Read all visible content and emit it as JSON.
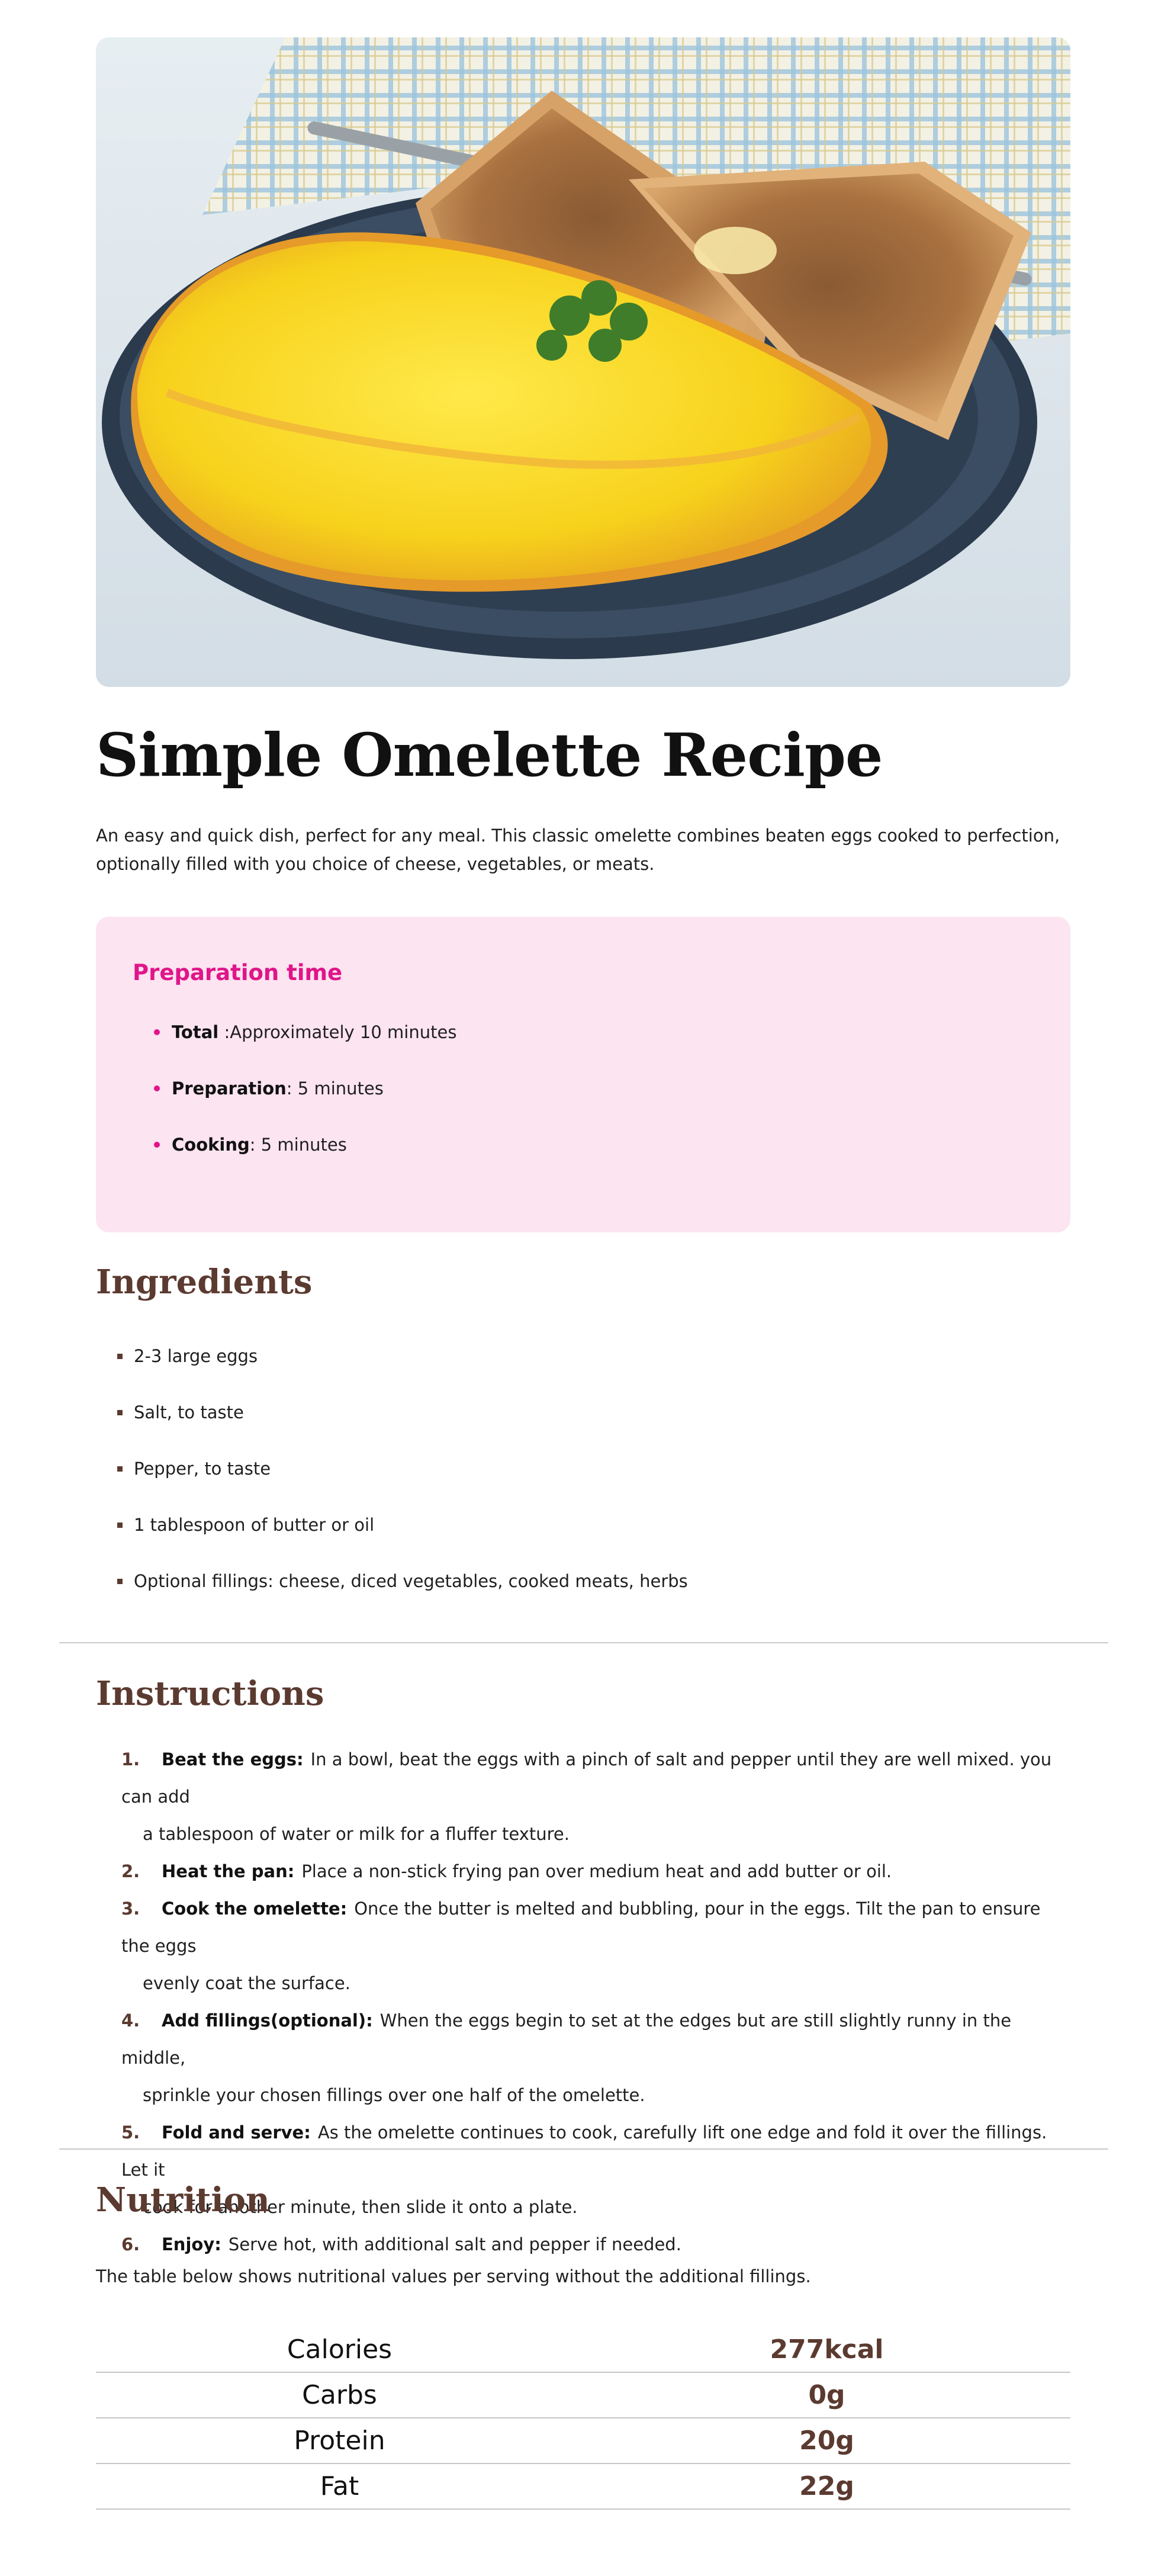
{
  "recipe": {
    "title": "Simple Omelette Recipe",
    "intro": "An easy and quick dish, perfect for any meal. This classic omelette combines beaten eggs cooked to perfection, optionally filled with you choice of cheese, vegetables, or meats."
  },
  "preparation": {
    "title": "Preparation time",
    "items": [
      {
        "label": "Total",
        "sep": " :",
        "value": "Approximately 10 minutes"
      },
      {
        "label": "Preparation",
        "sep": ": ",
        "value": "5 minutes"
      },
      {
        "label": "Cooking",
        "sep": ": ",
        "value": "5 minutes"
      }
    ]
  },
  "ingredients": {
    "title": "Ingredients",
    "items": [
      "2-3 large eggs",
      "Salt, to taste",
      "Pepper, to taste",
      "1 tablespoon of butter or oil",
      "Optional fillings: cheese, diced vegetables, cooked meats, herbs"
    ]
  },
  "instructions": {
    "title": "Instructions",
    "steps": [
      {
        "num": "1.",
        "lead": "Beat the eggs:",
        "line1": "In a bowl, beat the eggs with a pinch of salt and pepper until they are well mixed. you can add",
        "line2": "a tablespoon of water or milk for a fluffer texture."
      },
      {
        "num": "2.",
        "lead": "Heat the pan:",
        "line1": "Place a non-stick frying pan over medium heat and add butter or oil.",
        "line2": ""
      },
      {
        "num": "3.",
        "lead": "Cook the omelette:",
        "line1": "Once the butter is melted and bubbling, pour in the eggs. Tilt the pan to ensure the eggs",
        "line2": "evenly coat the surface."
      },
      {
        "num": "4.",
        "lead": "Add fillings(optional):",
        "line1": "When the eggs begin to set at the edges but are still slightly runny in the middle,",
        "line2": "sprinkle your chosen fillings over one half of the omelette."
      },
      {
        "num": "5.",
        "lead": "Fold and serve:",
        "line1": "As the omelette continues to cook, carefully lift one edge and fold it over the fillings. Let it",
        "line2": "cook for another minute, then slide it onto a plate."
      },
      {
        "num": "6.",
        "lead": "Enjoy:",
        "line1": "Serve hot, with additional salt and pepper if needed.",
        "line2": ""
      }
    ]
  },
  "nutrition": {
    "title": "Nutrition",
    "intro": "The table below shows nutritional values per serving without the additional fillings.",
    "rows": [
      {
        "name": "Calories",
        "value": "277kcal"
      },
      {
        "name": "Carbs",
        "value": "0g"
      },
      {
        "name": "Protein",
        "value": "20g"
      },
      {
        "name": "Fat",
        "value": "22g"
      }
    ]
  },
  "colors": {
    "accent_pink": "#e0158a",
    "prep_bg": "#fce4f0",
    "heading_brown": "#5b3a30"
  }
}
